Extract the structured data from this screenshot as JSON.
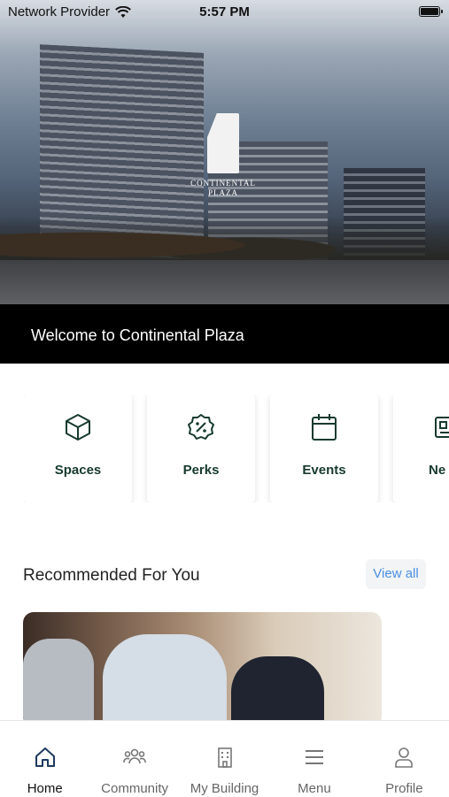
{
  "status_bar": {
    "carrier": "Network Provider",
    "time": "5:57 PM"
  },
  "hero": {
    "logo_text_line1": "CONTINENTAL",
    "logo_text_line2": "PLAZA",
    "welcome": "Welcome to Continental Plaza"
  },
  "quick_actions": [
    {
      "label": "Spaces",
      "icon": "cube-icon"
    },
    {
      "label": "Perks",
      "icon": "percent-badge-icon"
    },
    {
      "label": "Events",
      "icon": "calendar-icon"
    },
    {
      "label": "Ne",
      "icon": "news-icon"
    }
  ],
  "recommended": {
    "title": "Recommended For You",
    "view_all": "View all"
  },
  "bottom_nav": [
    {
      "label": "Home",
      "icon": "home-icon",
      "active": true
    },
    {
      "label": "Community",
      "icon": "people-icon",
      "active": false
    },
    {
      "label": "My Building",
      "icon": "building-icon",
      "active": false
    },
    {
      "label": "Menu",
      "icon": "menu-icon",
      "active": false
    },
    {
      "label": "Profile",
      "icon": "user-icon",
      "active": false
    }
  ],
  "colors": {
    "accent_dark_green": "#173a2f",
    "nav_active": "#1e3a5f",
    "link_blue": "#4a90e2"
  }
}
